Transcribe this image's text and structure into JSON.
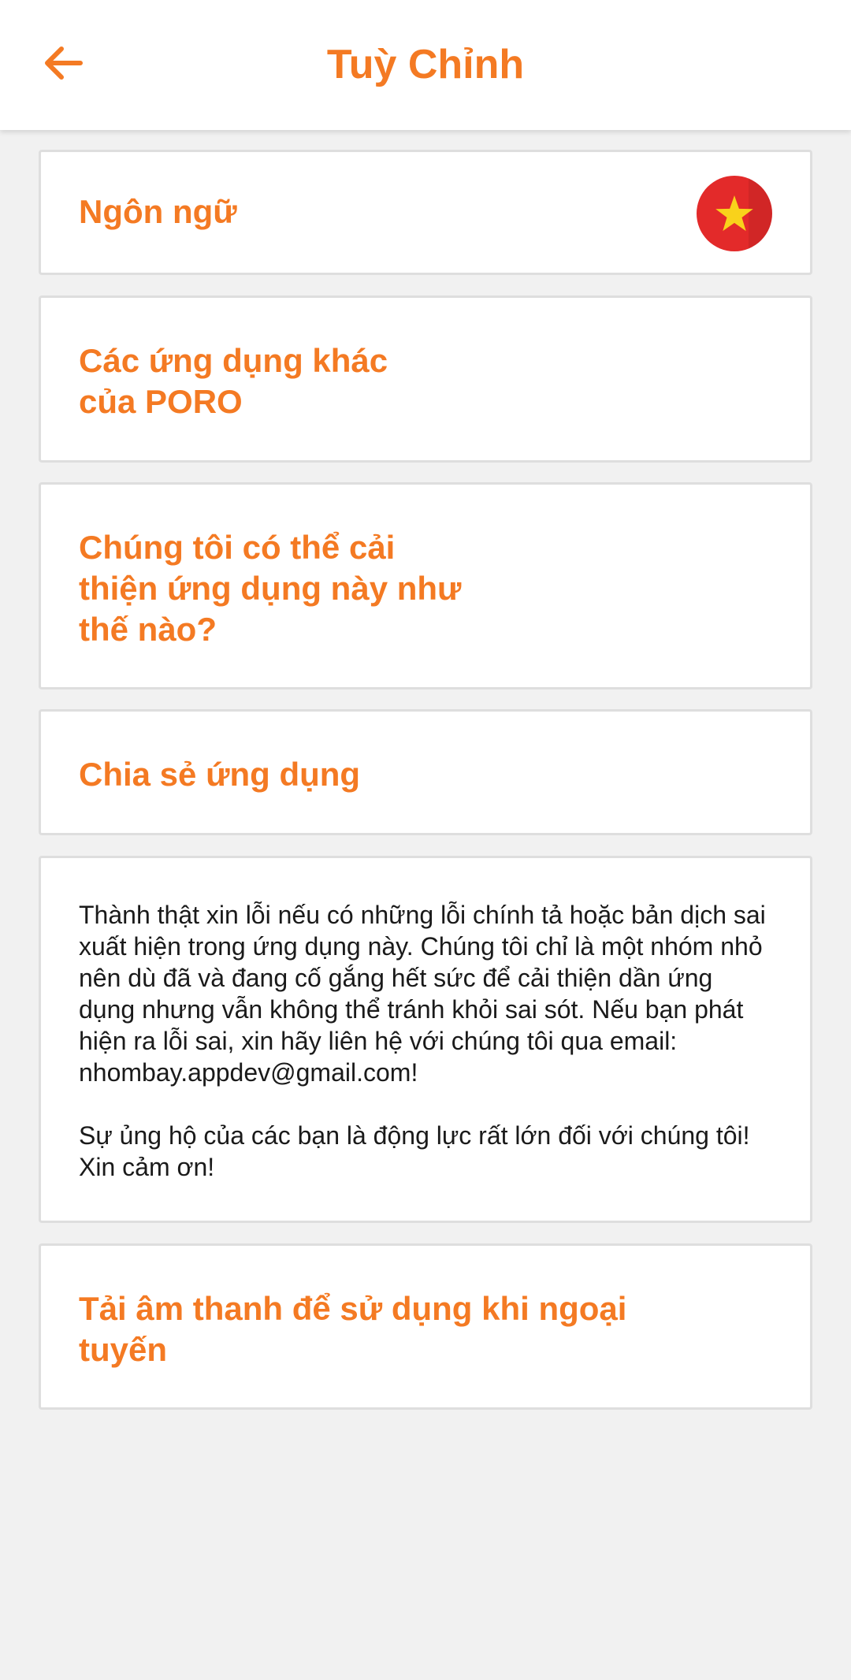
{
  "header": {
    "title": "Tuỳ Chỉnh",
    "back_icon": "arrow-left-icon"
  },
  "colors": {
    "accent": "#f47a23",
    "background": "#f1f1f1",
    "card": "#ffffff",
    "flag_red": "#e32a2a",
    "flag_star": "#f9d21b"
  },
  "settings": {
    "language_label": "Ngôn ngữ",
    "language_flag_icon": "vietnam-flag-icon",
    "other_apps_label": "Các ứng dụng khác\ncủa PORO",
    "improve_label": "Chúng tôi có thể cải\nthiện ứng dụng này như\nthế nào?",
    "share_label": "Chia sẻ ứng dụng",
    "notice_paragraph_1": "Thành thật xin lỗi nếu có những lỗi chính tả hoặc bản dịch sai xuất hiện trong ứng dụng này. Chúng tôi chỉ là một nhóm nhỏ nên dù đã và đang cố gắng hết sức để cải thiện dần ứng dụng nhưng vẫn không thể tránh khỏi sai sót. Nếu bạn phát hiện ra lỗi sai, xin hãy liên hệ với chúng tôi qua email: nhombay.appdev@gmail.com!",
    "notice_paragraph_2": "Sự ủng hộ của các bạn là động lực rất lớn đối với chúng tôi! Xin cảm ơn!",
    "offline_audio_label": "Tải âm thanh để sử dụng khi ngoại\ntuyến"
  }
}
